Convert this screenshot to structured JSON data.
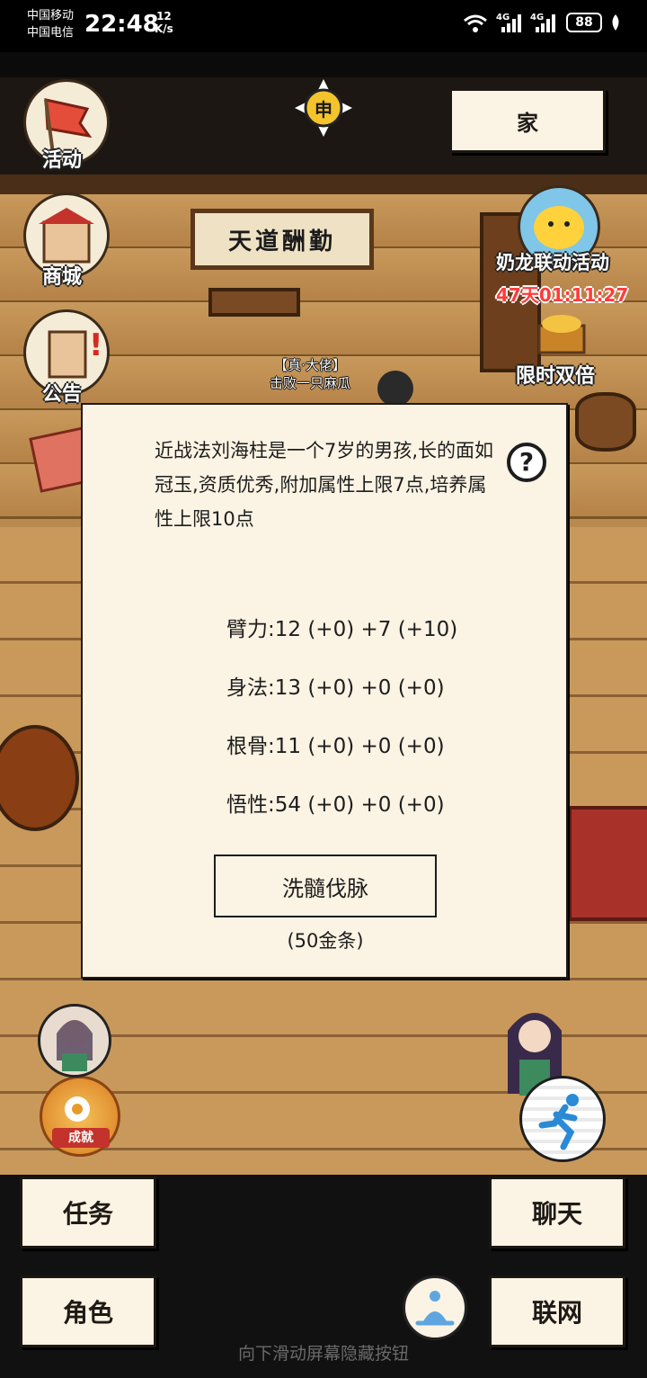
{
  "status_bar": {
    "carrier_1": "中国移动",
    "carrier_2": "中国电信",
    "time": "22:48",
    "speed_value": "12",
    "speed_unit": "K/s",
    "net_1": "4G",
    "net_2": "4G",
    "battery": "88"
  },
  "top": {
    "activity_label": "活动",
    "day_badge": "申",
    "home_label": "家"
  },
  "side_menu": {
    "shop_label": "商城",
    "notice_label": "公告"
  },
  "event": {
    "label": "奶龙联动活动",
    "timer": "47天01:11:27",
    "double_label": "限时双倍"
  },
  "scene": {
    "sign_text": "天道酬勤",
    "npc_title": "【真·大佬】",
    "npc_name": "击败一只麻瓜",
    "badge_label": "成就"
  },
  "dialog": {
    "description": "近战法刘海柱是一个7岁的男孩,长的面如冠玉,资质优秀,附加属性上限7点,培养属性上限10点",
    "help_symbol": "?",
    "stats": [
      "臂力:12 (+0) +7 (+10)",
      "身法:13 (+0) +0 (+0)",
      "根骨:11 (+0) +0 (+0)",
      "悟性:54 (+0) +0 (+0)"
    ],
    "action_label": "洗髓伐脉",
    "action_cost": "(50金条)"
  },
  "bottom": {
    "task_label": "任务",
    "chat_label": "聊天",
    "role_label": "角色",
    "network_label": "联网",
    "hint": "向下滑动屏幕隐藏按钮"
  }
}
